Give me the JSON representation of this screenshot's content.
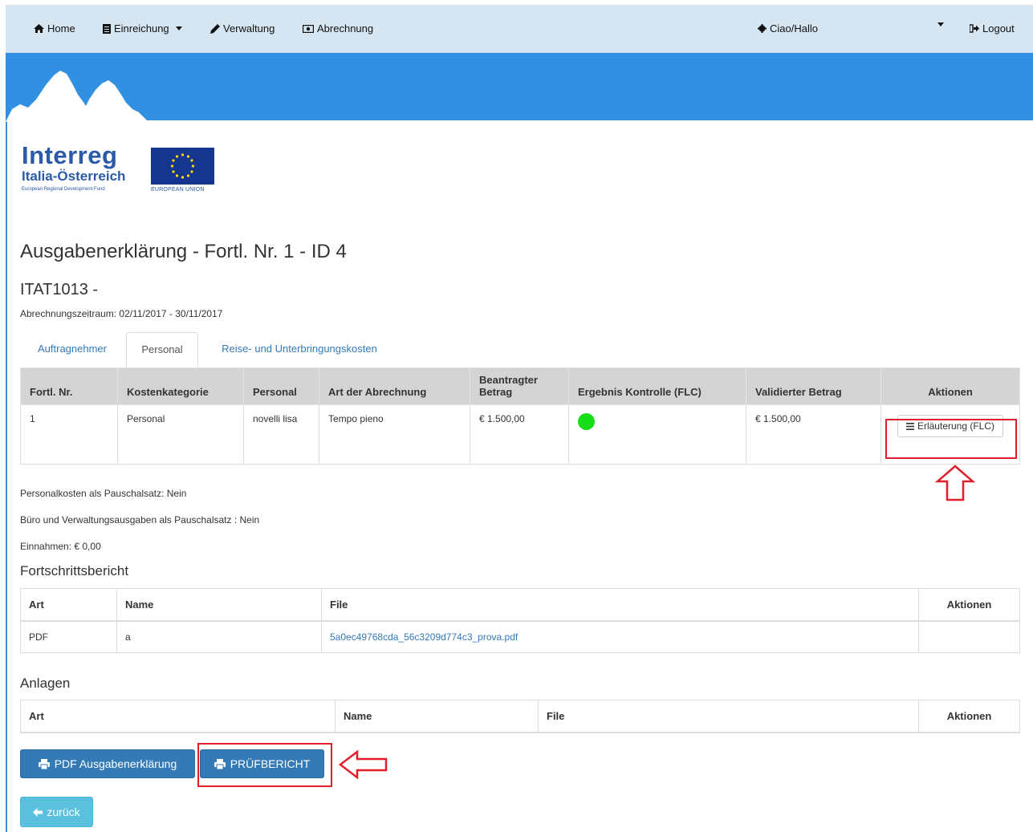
{
  "nav": {
    "home": "Home",
    "einreichung": "Einreichung",
    "verwaltung": "Verwaltung",
    "abrechnung": "Abrechnung",
    "user": "Ciao/Hallo",
    "logout": "Logout"
  },
  "logo": {
    "line1": "Interreg",
    "line2": "Italia-Österreich",
    "line3": "European Regional Development Fund",
    "eu": "EUROPEAN UNION"
  },
  "page": {
    "title": "Ausgabenerklärung - Fortl. Nr. 1 - ID 4",
    "project": "ITAT1013 -",
    "period": "Abrechnungszeitraum: 02/11/2017 - 30/11/2017"
  },
  "tabs": [
    {
      "label": "Auftragnehmer"
    },
    {
      "label": "Personal",
      "active": true
    },
    {
      "label": "Reise- und Unterbringungskosten"
    }
  ],
  "cost_table": {
    "headers": [
      "Fortl. Nr.",
      "Kostenkategorie",
      "Personal",
      "Art der Abrechnung",
      "Beantragter Betrag",
      "Ergebnis Kontrolle (FLC)",
      "Validierter Betrag",
      "Aktionen"
    ],
    "rows": [
      {
        "nr": "1",
        "kategorie": "Personal",
        "personal": "novelli lisa",
        "art": "Tempo pieno",
        "beantragt": "€ 1.500,00",
        "ergebnis_color": "#17de17",
        "validiert": "€ 1.500,00",
        "action": "Erläuterung (FLC)"
      }
    ]
  },
  "info": {
    "personalkosten": "Personalkosten als Pauschalsatz: Nein",
    "buero": "Büro und Verwaltungsausgaben als Pauschalsatz : Nein",
    "einnahmen": "Einnahmen: € 0,00"
  },
  "progress_report": {
    "title": "Fortschrittsbericht",
    "headers": [
      "Art",
      "Name",
      "File",
      "Aktionen"
    ],
    "rows": [
      {
        "art": "PDF",
        "name": "a",
        "file": "5a0ec49768cda_56c3209d774c3_prova.pdf"
      }
    ]
  },
  "attachments": {
    "title": "Anlagen",
    "headers": [
      "Art",
      "Name",
      "File",
      "Aktionen"
    ]
  },
  "buttons": {
    "pdf": "PDF Ausgabenerklärung",
    "report": "PRÜFBERICHT",
    "back": "zurück"
  },
  "colors": {
    "banner": "#3290e2",
    "navbar": "#d5e5f1",
    "primary": "#337ab7",
    "info": "#5bc0de",
    "annotation": "#e21e2b"
  }
}
